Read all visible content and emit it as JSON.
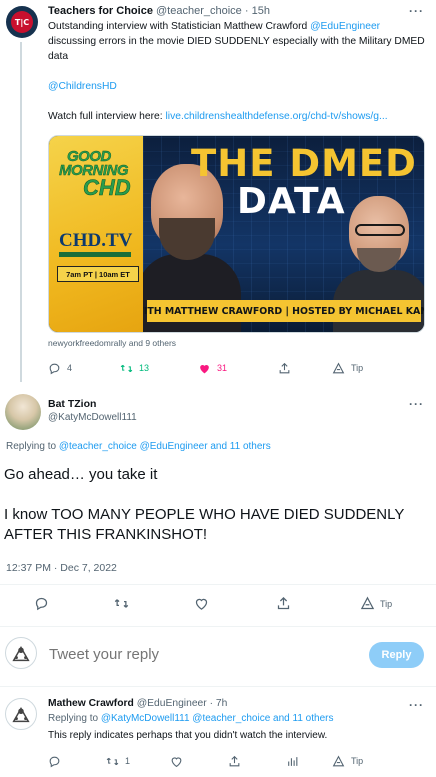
{
  "tweet1": {
    "avatar_text": "T|C",
    "name": "Teachers for Choice",
    "handle": "@teacher_choice",
    "time": "15h",
    "text_part1": "Outstanding interview with Statistician Matthew Crawford ",
    "mention": "@EduEngineer",
    "text_part2": " discussing errors in the movie DIED SUDDENLY especially with the Military DMED data",
    "hashtag": "@ChildrensHD",
    "watch_label": "Watch full interview here: ",
    "watch_link": "live.childrenshealthdefense.org/chd-tv/shows/g...",
    "media": {
      "good": "GOOD",
      "morning": "MORNING",
      "chd": "CHD",
      "chdtv": "CHD.TV",
      "time": "7am PT | 10am ET",
      "title": "THE DMED",
      "subtitle": "DATA",
      "banner": "WITH MATTHEW CRAWFORD | HOSTED BY MICHAEL KANE"
    },
    "liked_by": "newyorkfreedomrally and 9 others",
    "replies": "4",
    "retweets": "13",
    "likes": "31",
    "tip": "Tip"
  },
  "main_tweet": {
    "name": "Bat TZion",
    "handle": "@KatyMcDowell111",
    "replying_label": "Replying to ",
    "replying_mentions": "@teacher_choice @EduEngineer and 11 others",
    "line1": "Go ahead… you take it",
    "line2": "I know TOO MANY PEOPLE WHO HAVE DIED SUDDENLY AFTER THIS FRANKINSHOT!",
    "timestamp": "12:37 PM · Dec 7, 2022",
    "tip": "Tip"
  },
  "compose": {
    "placeholder": "Tweet your reply",
    "button": "Reply"
  },
  "reply_tweet": {
    "name": "Mathew Crawford",
    "handle": "@EduEngineer",
    "time": "7h",
    "replying_label": "Replying to ",
    "replying_mentions": "@KatyMcDowell111 @teacher_choice and 11 others",
    "text": "This reply indicates perhaps that you didn't watch the interview.",
    "retweets": "1",
    "tip": "Tip"
  },
  "colors": {
    "accent": "#1d9bf0",
    "retweet": "#00ba7c",
    "like": "#f91880",
    "muted": "#536471"
  }
}
